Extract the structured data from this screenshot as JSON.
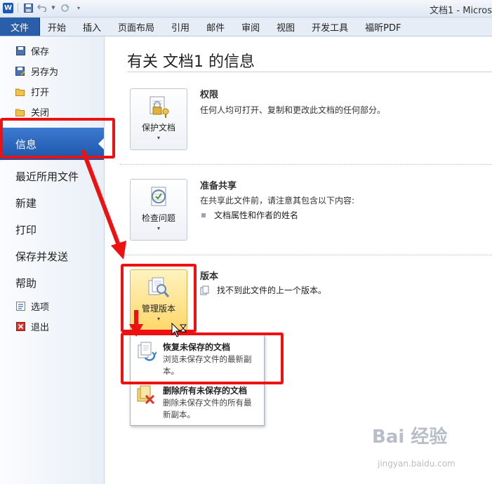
{
  "app": {
    "window_title": "文档1 - Micros",
    "file_tab": "文件",
    "tabs": [
      "开始",
      "插入",
      "页面布局",
      "引用",
      "邮件",
      "审阅",
      "视图",
      "开发工具",
      "福昕PDF"
    ]
  },
  "nav": {
    "small_items_top": [
      {
        "label": "保存",
        "icon": "save-icon"
      },
      {
        "label": "另存为",
        "icon": "save-as-icon"
      },
      {
        "label": "打开",
        "icon": "open-folder-icon"
      },
      {
        "label": "关闭",
        "icon": "close-doc-icon"
      }
    ],
    "selected": "信息",
    "big_items": [
      "最近所用文件",
      "新建",
      "打印",
      "保存并发送",
      "帮助"
    ],
    "small_items_bottom": [
      {
        "label": "选项",
        "icon": "options-icon"
      },
      {
        "label": "退出",
        "icon": "exit-icon"
      }
    ]
  },
  "main": {
    "title": "有关 文档1 的信息",
    "sections": [
      {
        "button_label": "保护文档",
        "heading": "权限",
        "text": "任何人均可打开、复制和更改此文档的任何部分。"
      },
      {
        "button_label": "检查问题",
        "heading": "准备共享",
        "text": "在共享此文件前，请注意其包含以下内容:",
        "bullets": [
          "文档属性和作者的姓名"
        ]
      },
      {
        "button_label": "管理版本",
        "heading": "版本",
        "text": "找不到此文件的上一个版本。"
      }
    ],
    "dropdown_arrow": "▾"
  },
  "menu": {
    "items": [
      {
        "title": "恢复未保存的文档",
        "desc": "浏览未保存文件的最新副本。"
      },
      {
        "title": "删除所有未保存的文档",
        "desc": "删除未保存文件的所有最新副本。"
      }
    ]
  },
  "watermark": {
    "logo": "Bai 经验",
    "url": "jingyan.baidu.com"
  },
  "colors": {
    "accent": "#2a5ea8",
    "annotation": "#ee1111",
    "highlight": "#ffd76a"
  }
}
